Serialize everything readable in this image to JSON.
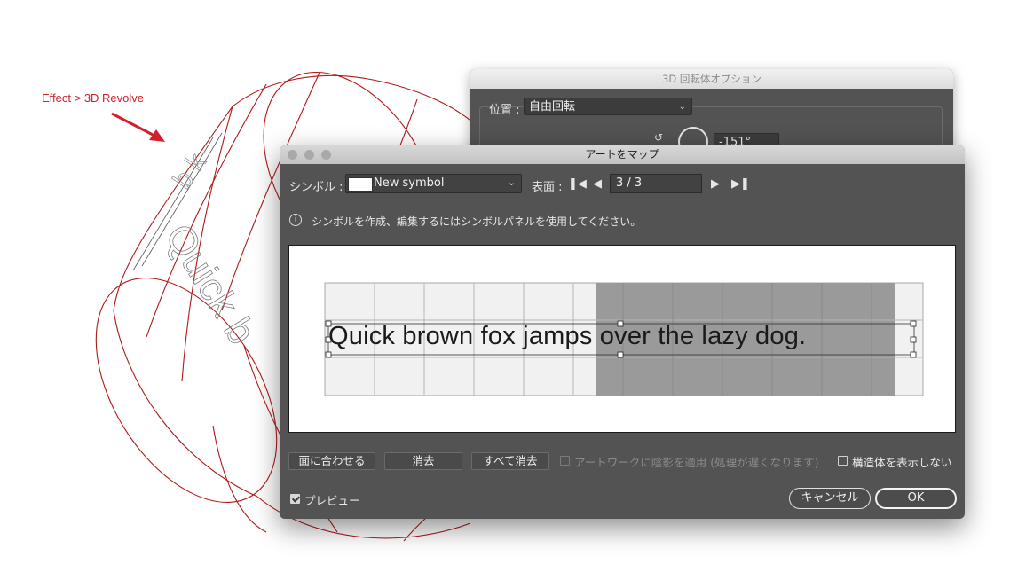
{
  "annotation": {
    "text": "Effect > 3D Revolve",
    "color": "#d0202a"
  },
  "canvas": {
    "wrapped_text": "Quick b"
  },
  "back_dialog": {
    "title": "3D 回転体オプション",
    "position_label": "位置 :",
    "position_value": "自由回転",
    "angle_value": "-151°"
  },
  "dialog": {
    "title": "アートをマップ",
    "symbol_label": "シンボル :",
    "symbol_value": "New symbol",
    "surface_label": "表面 :",
    "surface_value": "3 / 3",
    "info_text": "シンボルを作成、編集するにはシンボルパネルを使用してください。",
    "preview_text": "Quick brown fox jamps over the lazy dog.",
    "buttons": {
      "scale_to_fit": "面に合わせる",
      "clear": "消去",
      "clear_all": "すべて消去",
      "cancel": "キャンセル",
      "ok": "OK"
    },
    "checkboxes": {
      "shade_artwork": {
        "label": "アートワークに陰影を適用 (処理が遅くなります)",
        "checked": false,
        "disabled": true
      },
      "invisible_geometry": {
        "label": "構造体を表示しない",
        "checked": false,
        "disabled": false
      },
      "preview": {
        "label": "プレビュー",
        "checked": true,
        "disabled": false
      }
    }
  },
  "colors": {
    "dialog_bg": "#535353",
    "outline_red": "#b01818",
    "grid_fill": "#f1f1f1",
    "grid_shaded": "#9a9a9a"
  }
}
